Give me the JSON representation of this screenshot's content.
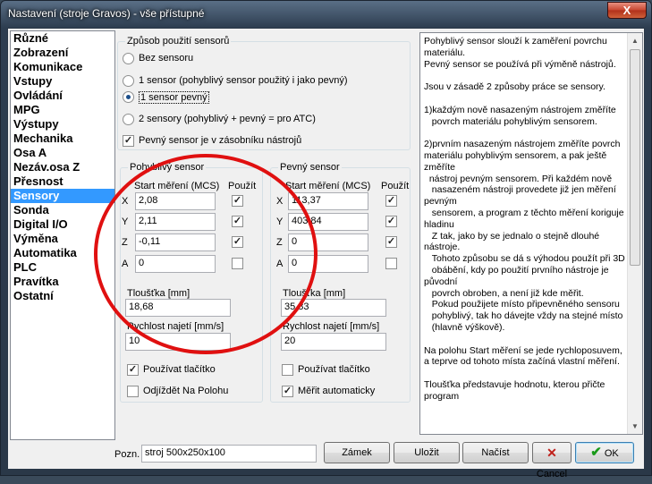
{
  "window": {
    "title": "Nastavení (stroje Gravos) - vše přístupné",
    "close_glyph": "X"
  },
  "categories": [
    "Různé",
    "Zobrazení",
    "Komunikace",
    "Vstupy",
    "Ovládání",
    "MPG",
    "Výstupy",
    "Mechanika",
    "Osa A",
    "Nezáv.osa Z",
    "Přesnost",
    "Sensory",
    "Sonda",
    "Digital I/O",
    "Výměna",
    "Automatika",
    "PLC",
    "Pravítka",
    "Ostatní"
  ],
  "selected_category": "Sensory",
  "usage": {
    "label": "Způsob použití sensorů",
    "options": [
      "Bez sensoru",
      "1 sensor (pohyblivý sensor použitý i jako pevný)",
      "1 sensor pevný",
      "2 sensory (pohyblivý + pevný = pro ATC)"
    ],
    "selected_index": 2,
    "in_magazine_label": "Pevný sensor je v zásobníku nástrojů",
    "in_magazine_checked": true
  },
  "movable": {
    "label": "Pohyblivý sensor",
    "start_header": "Start měření (MCS)",
    "use_header": "Použít",
    "rows": [
      {
        "axis": "X",
        "value": "2,08",
        "use": true
      },
      {
        "axis": "Y",
        "value": "2,11",
        "use": true
      },
      {
        "axis": "Z",
        "value": "-0,11",
        "use": true
      },
      {
        "axis": "A",
        "value": "0",
        "use": false
      }
    ],
    "thickness_label": "Tloušťka [mm]",
    "thickness": "18,68",
    "speed_label": "Rychlost najetí [mm/s]",
    "speed": "10",
    "use_button_label": "Používat tlačítko",
    "use_button": true,
    "retract_label": "Odjíždět Na Polohu",
    "retract": false
  },
  "fixed": {
    "label": "Pevný sensor",
    "start_header": "Start měření (MCS)",
    "use_header": "Použít",
    "rows": [
      {
        "axis": "X",
        "value": "113,37",
        "use": true
      },
      {
        "axis": "Y",
        "value": "403,84",
        "use": true
      },
      {
        "axis": "Z",
        "value": "0",
        "use": true
      },
      {
        "axis": "A",
        "value": "0",
        "use": false
      }
    ],
    "thickness_label": "Tloušťka [mm]",
    "thickness": "35,83",
    "speed_label": "Rychlost najetí [mm/s]",
    "speed": "20",
    "use_button_label": "Používat tlačítko",
    "use_button": false,
    "auto_label": "Měřit automaticky",
    "auto": true
  },
  "help_text": "Pohyblivý sensor slouží k zaměření povrchu materiálu.\nPevný sensor se používá při výměně nástrojů.\n\nJsou v zásadě 2 způsoby práce se sensory.\n\n1)každým nově nasazeným nástrojem změříte\n   povrch materiálu pohyblivým sensorem.\n\n2)prvním nasazeným nástrojem změříte povrch materiálu pohyblivým sensorem, a pak ještě změříte\n  nástroj pevným sensorem. Při každém nově\n   nasazeném nástroji provedete již jen měření pevným\n   sensorem, a program z těchto měření koriguje hladinu\n   Z tak, jako by se jednalo o stejně dlouhé nástroje.\n   Tohoto způsobu se dá s výhodou použít při 3D\n   obábění, kdy po použití prvního nástroje je původní\n   povrch obroben, a není již kde měřit.\n   Pokud použijete místo připevněného sensoru\n   pohyblivý, tak ho dávejte vždy na stejné místo\n   (hlavně výškově).\n\nNa polohu Start měření se jede rychloposuvem,\na teprve od tohoto místa začíná vlastní měření.\n\nTloušťka představuje hodnotu, kterou přičte program",
  "footer": {
    "note_label": "Pozn.",
    "note_value": "stroj 500x250x100",
    "lock": "Zámek",
    "save": "Uložit",
    "load": "Načíst",
    "cancel": "Cancel",
    "ok": "OK"
  }
}
